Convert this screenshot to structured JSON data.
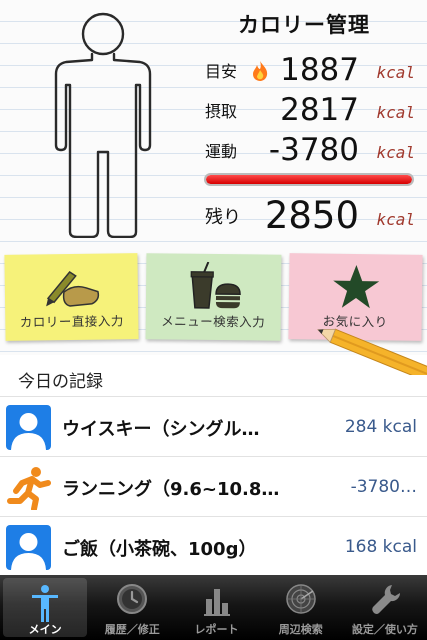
{
  "header": {
    "title": "カロリー管理"
  },
  "summary": {
    "target": {
      "label": "目安",
      "value": "1887",
      "unit": "kcal",
      "icon": "flame-icon"
    },
    "intake": {
      "label": "摂取",
      "value": "2817",
      "unit": "kcal"
    },
    "exercise": {
      "label": "運動",
      "value": "-3780",
      "unit": "kcal"
    },
    "progress_fraction": 1.0,
    "remaining": {
      "label": "残り",
      "value": "2850",
      "unit": "kcal"
    }
  },
  "notes": {
    "direct_input": "カロリー直接入力",
    "menu_search": "メニュー検索入力",
    "favorites": "お気に入り"
  },
  "records": {
    "title": "今日の記録",
    "items": [
      {
        "name": "ウイスキー（シングル…",
        "calories": "284 kcal",
        "icon": "avatar-icon"
      },
      {
        "name": "ランニング（9.6~10.8…",
        "calories": "-3780…",
        "icon": "running-icon"
      },
      {
        "name": "ご飯（小茶碗、100g）",
        "calories": "168 kcal",
        "icon": "avatar-icon"
      }
    ]
  },
  "tabs": [
    {
      "label": "メイン",
      "icon": "person-icon",
      "active": true
    },
    {
      "label": "履歴／修正",
      "icon": "clock-icon",
      "active": false
    },
    {
      "label": "レポート",
      "icon": "bar-chart-icon",
      "active": false
    },
    {
      "label": "周辺検索",
      "icon": "radar-icon",
      "active": false
    },
    {
      "label": "設定／使い方",
      "icon": "wrench-icon",
      "active": false
    }
  ],
  "colors": {
    "unit": "#a13a2e",
    "progress": "#e00000",
    "calorie_text": "#3a5a8c",
    "avatar_blue": "#1e7ee6",
    "running_orange": "#f08a1c"
  }
}
